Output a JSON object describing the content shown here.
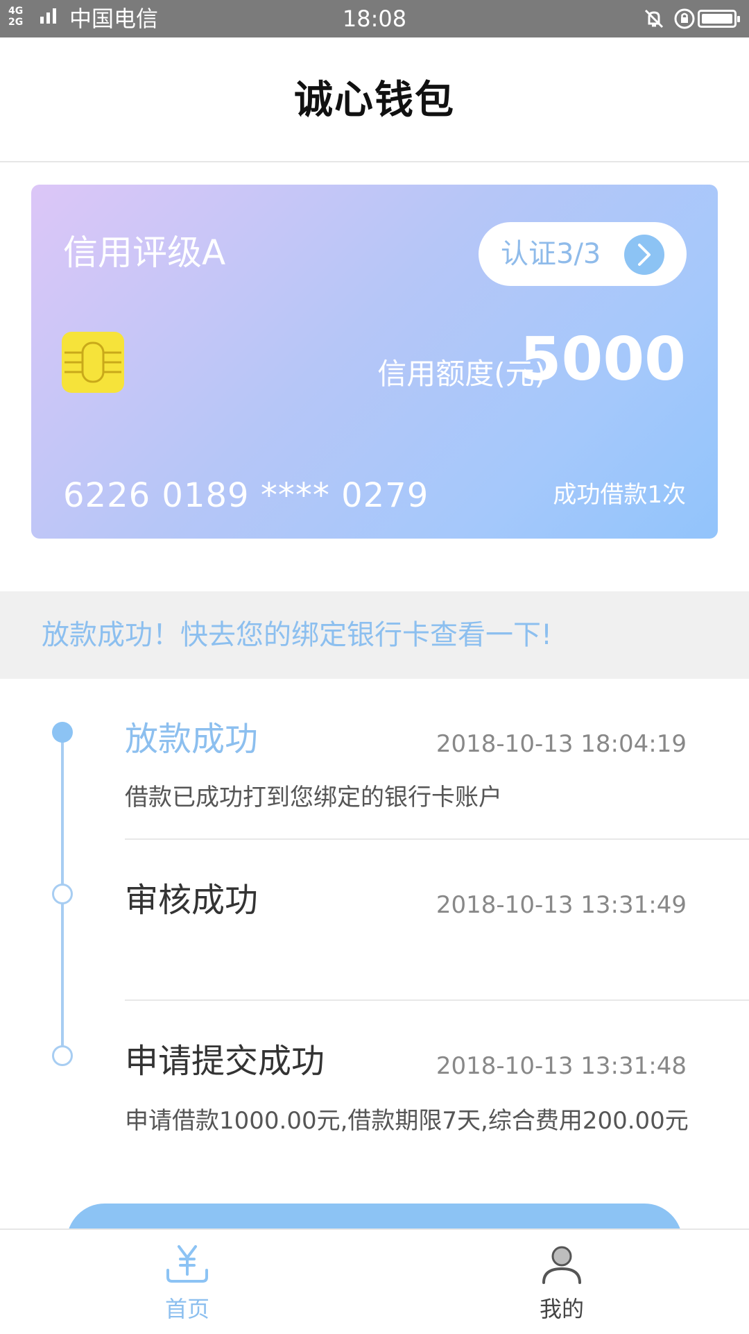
{
  "status_bar": {
    "network_top": "4G",
    "network_bottom": "2G",
    "carrier": "中国电信",
    "time": "18:08"
  },
  "header": {
    "title": "诚心钱包"
  },
  "card": {
    "credit_rating": "信用评级A",
    "certification": "认证3/3",
    "limit_label": "信用额度(元)",
    "limit_value": "5000",
    "card_number": "6226 0189 **** 0279",
    "loan_count": "成功借款1次"
  },
  "notice": {
    "text": "放款成功！快去您的绑定银行卡查看一下!"
  },
  "timeline": [
    {
      "title": "放款成功",
      "time": "2018-10-13 18:04:19",
      "desc": "借款已成功打到您绑定的银行卡账户",
      "active": true
    },
    {
      "title": "审核成功",
      "time": "2018-10-13 13:31:49",
      "desc": "",
      "active": false
    },
    {
      "title": "申请提交成功",
      "time": "2018-10-13 13:31:48",
      "desc": "申请借款1000.00元,借款期限7天,综合费用200.00元",
      "active": false
    }
  ],
  "tabbar": {
    "home": {
      "label": "首页",
      "icon": "yuan-icon"
    },
    "mine": {
      "label": "我的",
      "icon": "person-icon"
    }
  },
  "colors": {
    "accent": "#8cc3f4",
    "status_bar": "#7b7b7b",
    "chip": "#f6e33a"
  }
}
